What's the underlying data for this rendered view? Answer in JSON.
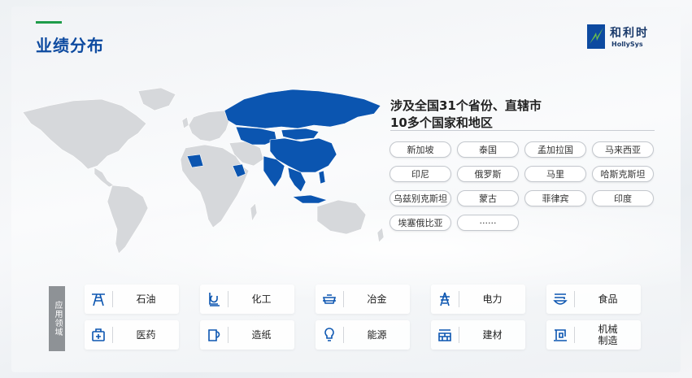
{
  "header": {
    "title": "业绩分布"
  },
  "logo": {
    "text": "和利时",
    "subtitle": "HollySys"
  },
  "coverage": {
    "line1": "涉及全国31个省份、直辖市",
    "line2": "10多个国家和地区"
  },
  "countries": [
    "新加坡",
    "泰国",
    "孟加拉国",
    "马来西亚",
    "印尼",
    "俄罗斯",
    "马里",
    "哈斯克斯坦",
    "乌兹别克斯坦",
    "蒙古",
    "菲律宾",
    "印度",
    "埃塞俄比亚",
    "······"
  ],
  "industry_label": "应用领域",
  "industries": [
    {
      "name": "石油",
      "icon": "oil-derrick-icon"
    },
    {
      "name": "化工",
      "icon": "chemical-flask-icon"
    },
    {
      "name": "冶金",
      "icon": "metallurgy-cart-icon"
    },
    {
      "name": "电力",
      "icon": "power-tower-icon"
    },
    {
      "name": "食品",
      "icon": "food-bowl-icon"
    },
    {
      "name": "医药",
      "icon": "medicine-kit-icon"
    },
    {
      "name": "造纸",
      "icon": "paper-roll-icon"
    },
    {
      "name": "能源",
      "icon": "energy-bulb-icon"
    },
    {
      "name": "建材",
      "icon": "building-materials-icon"
    },
    {
      "name": "机械\n制造",
      "icon": "sewing-machine-icon"
    }
  ],
  "colors": {
    "accent": "#0d4aa0",
    "highlight": "#0b55b0",
    "green": "#1f9c4a",
    "land": "#d6d8db"
  }
}
